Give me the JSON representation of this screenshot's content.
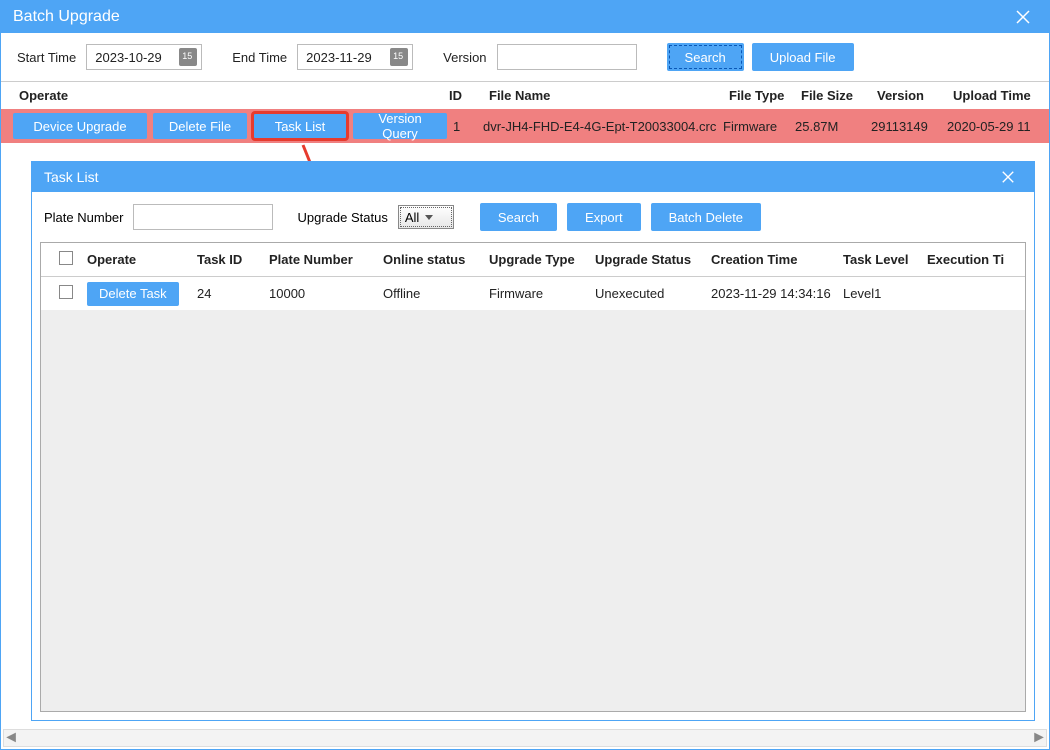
{
  "window": {
    "title": "Batch Upgrade"
  },
  "filters": {
    "start_label": "Start Time",
    "start_value": "2023-10-29",
    "end_label": "End Time",
    "end_value": "2023-11-29",
    "version_label": "Version",
    "version_value": "",
    "search_btn": "Search",
    "upload_btn": "Upload File"
  },
  "columns": {
    "operate": "Operate",
    "id": "ID",
    "file_name": "File Name",
    "file_type": "File Type",
    "file_size": "File Size",
    "version": "Version",
    "upload_time": "Upload Time"
  },
  "row": {
    "device_upgrade": "Device Upgrade",
    "delete_file": "Delete File",
    "task_list": "Task List",
    "version_query": "Version Query",
    "id": "1",
    "file_name": "dvr-JH4-FHD-E4-4G-Ept-T20033004.crc",
    "file_type": "Firmware",
    "file_size": "25.87M",
    "version": "29113149",
    "upload_time": "2020-05-29 11"
  },
  "dlg": {
    "title": "Task List",
    "plate_label": "Plate Number",
    "plate_value": "",
    "status_label": "Upgrade Status",
    "status_selected": "All",
    "search_btn": "Search",
    "export_btn": "Export",
    "batch_delete_btn": "Batch Delete",
    "columns": {
      "operate": "Operate",
      "task_id": "Task ID",
      "plate_number": "Plate Number",
      "online_status": "Online status",
      "upgrade_type": "Upgrade Type",
      "upgrade_status": "Upgrade Status",
      "creation_time": "Creation Time",
      "task_level": "Task Level",
      "execution_time": "Execution Ti"
    },
    "rows": [
      {
        "delete_task": "Delete Task",
        "task_id": "24",
        "plate_number": "10000",
        "online_status": "Offline",
        "upgrade_type": "Firmware",
        "upgrade_status": "Unexecuted",
        "creation_time": "2023-11-29 14:34:16",
        "task_level": "Level1",
        "execution_time": ""
      }
    ]
  }
}
